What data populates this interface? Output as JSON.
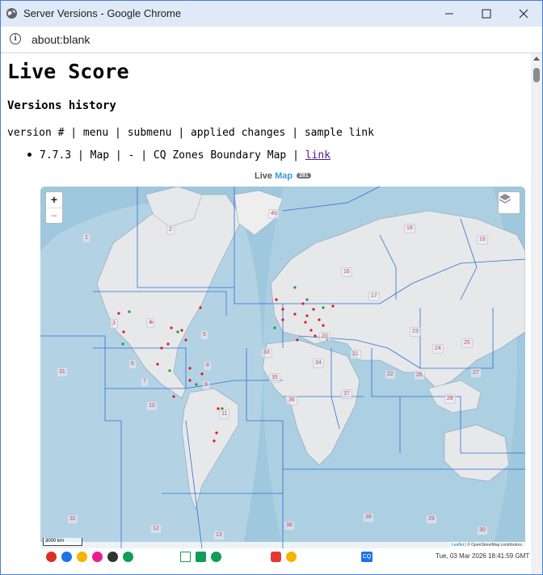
{
  "window": {
    "title": "Server Versions - Google Chrome"
  },
  "address": {
    "url": "about:blank"
  },
  "page": {
    "heading": "Live Score",
    "subheading": "Versions history",
    "columns": "version # | menu | submenu | applied changes | sample link",
    "entry": {
      "text": "7.7.3 | Map | - | CQ Zones Boundary Map | ",
      "link": "link"
    }
  },
  "map": {
    "title_a": "Live",
    "title_b": "Map",
    "badge": "281",
    "zoom_in": "+",
    "zoom_out": "−",
    "scale": "3000 km",
    "attribution_link": "Leaflet",
    "attribution_text": " | © OpenStreetMap contributors",
    "zones": [
      "1",
      "2",
      "3",
      "4",
      "5",
      "6",
      "7",
      "8",
      "9",
      "10",
      "11",
      "12",
      "13",
      "16",
      "17",
      "18",
      "19",
      "20",
      "21",
      "22",
      "23",
      "24",
      "25",
      "26",
      "27",
      "28",
      "29",
      "30",
      "31",
      "32",
      "33",
      "34",
      "35",
      "36",
      "37",
      "38",
      "39",
      "40"
    ]
  },
  "toolbar": {
    "timestamp": "Tue, 03 Mar 2026 18:41:59 GMT",
    "cq_label": "CQ"
  }
}
